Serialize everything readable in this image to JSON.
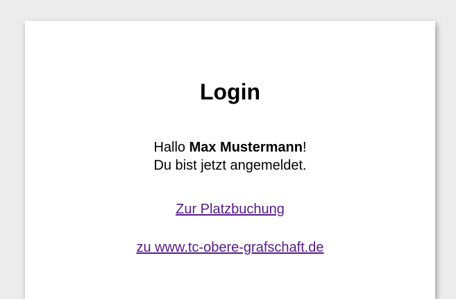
{
  "login": {
    "title": "Login",
    "greeting_prefix": "Hallo ",
    "user_name": "Max Mustermann",
    "greeting_suffix": "!",
    "status_text": "Du bist jetzt angemeldet.",
    "booking_link_label": "Zur Platzbuchung",
    "site_link_label": "zu www.tc-obere-grafschaft.de"
  },
  "colors": {
    "page_background": "#ececec",
    "card_background": "#ffffff",
    "visited_link": "#551a8b"
  }
}
